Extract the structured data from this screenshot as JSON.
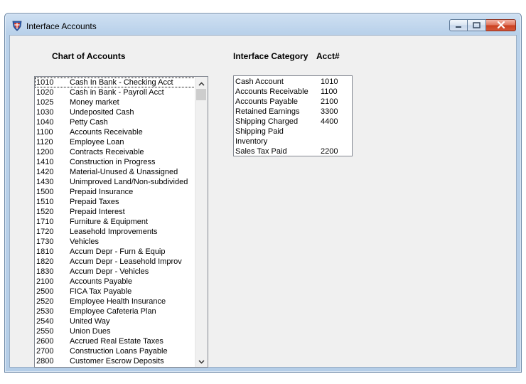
{
  "window": {
    "title": "Interface Accounts"
  },
  "chart_of_accounts": {
    "header": "Chart of Accounts",
    "items": [
      {
        "num": "1010",
        "name": "Cash In Bank - Checking Acct"
      },
      {
        "num": "1020",
        "name": "Cash in Bank - Payroll Acct"
      },
      {
        "num": "1025",
        "name": "Money market"
      },
      {
        "num": "1030",
        "name": "Undeposited Cash"
      },
      {
        "num": "1040",
        "name": "Petty Cash"
      },
      {
        "num": "1100",
        "name": "Accounts Receivable"
      },
      {
        "num": "1120",
        "name": "Employee Loan"
      },
      {
        "num": "1200",
        "name": "Contracts Receivable"
      },
      {
        "num": "1410",
        "name": "Construction in Progress"
      },
      {
        "num": "1420",
        "name": "Material-Unused & Unassigned"
      },
      {
        "num": "1430",
        "name": "Unimproved Land/Non-subdivided"
      },
      {
        "num": "1500",
        "name": "Prepaid Insurance"
      },
      {
        "num": "1510",
        "name": "Prepaid Taxes"
      },
      {
        "num": "1520",
        "name": "Prepaid Interest"
      },
      {
        "num": "1710",
        "name": "Furniture & Equipment"
      },
      {
        "num": "1720",
        "name": "Leasehold Improvements"
      },
      {
        "num": "1730",
        "name": "Vehicles"
      },
      {
        "num": "1810",
        "name": "Accum Depr - Furn & Equip"
      },
      {
        "num": "1820",
        "name": "Accum Depr - Leasehold Improv"
      },
      {
        "num": "1830",
        "name": "Accum Depr - Vehicles"
      },
      {
        "num": "2100",
        "name": "Accounts Payable"
      },
      {
        "num": "2500",
        "name": "FICA Tax Payable"
      },
      {
        "num": "2520",
        "name": "Employee Health Insurance"
      },
      {
        "num": "2530",
        "name": "Employee Cafeteria Plan"
      },
      {
        "num": "2540",
        "name": "United Way"
      },
      {
        "num": "2550",
        "name": "Union Dues"
      },
      {
        "num": "2600",
        "name": "Accrued Real Estate Taxes"
      },
      {
        "num": "2700",
        "name": "Construction Loans Payable"
      },
      {
        "num": "2800",
        "name": "Customer Escrow Deposits"
      }
    ]
  },
  "interface": {
    "header_category": "Interface Category",
    "header_acct": "Acct#",
    "rows": [
      {
        "category": "Cash Account",
        "acct": "1010"
      },
      {
        "category": "Accounts Receivable",
        "acct": "1100"
      },
      {
        "category": "Accounts Payable",
        "acct": "2100"
      },
      {
        "category": "Retained Earnings",
        "acct": "3300"
      },
      {
        "category": "Shipping Charged",
        "acct": "4400"
      },
      {
        "category": "Shipping Paid",
        "acct": ""
      },
      {
        "category": "Inventory",
        "acct": ""
      },
      {
        "category": "Sales Tax Paid",
        "acct": "2200"
      }
    ]
  },
  "icons": {
    "app": "app-shield-icon",
    "minimize": "minimize-icon",
    "maximize": "maximize-icon",
    "close": "close-icon"
  }
}
